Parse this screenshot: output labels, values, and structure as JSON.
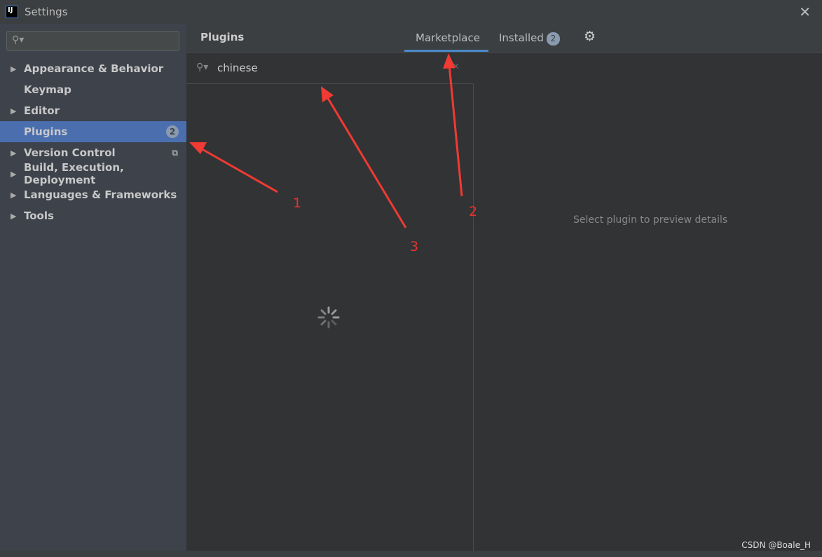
{
  "window": {
    "title": "Settings",
    "close": "✕"
  },
  "sidebar": {
    "search_placeholder": "",
    "items": [
      {
        "label": "Appearance & Behavior",
        "expandable": true
      },
      {
        "label": "Keymap",
        "expandable": false
      },
      {
        "label": "Editor",
        "expandable": true
      },
      {
        "label": "Plugins",
        "expandable": false,
        "badge": "2",
        "selected": true
      },
      {
        "label": "Version Control",
        "expandable": true
      },
      {
        "label": "Build, Execution, Deployment",
        "expandable": true
      },
      {
        "label": "Languages & Frameworks",
        "expandable": true
      },
      {
        "label": "Tools",
        "expandable": true
      }
    ]
  },
  "header": {
    "title": "Plugins",
    "tabs": [
      {
        "label": "Marketplace",
        "active": true
      },
      {
        "label": "Installed",
        "badge": "2"
      }
    ]
  },
  "plugin_search": {
    "value": "chinese"
  },
  "preview": {
    "empty_text": "Select plugin to preview details"
  },
  "annotations": {
    "n1": "1",
    "n2": "2",
    "n3": "3",
    "color": "#e8332f"
  },
  "watermark": "CSDN @Boale_H",
  "colors": {
    "accent": "#4b6eaf",
    "tab_underline": "#4a88c7"
  }
}
